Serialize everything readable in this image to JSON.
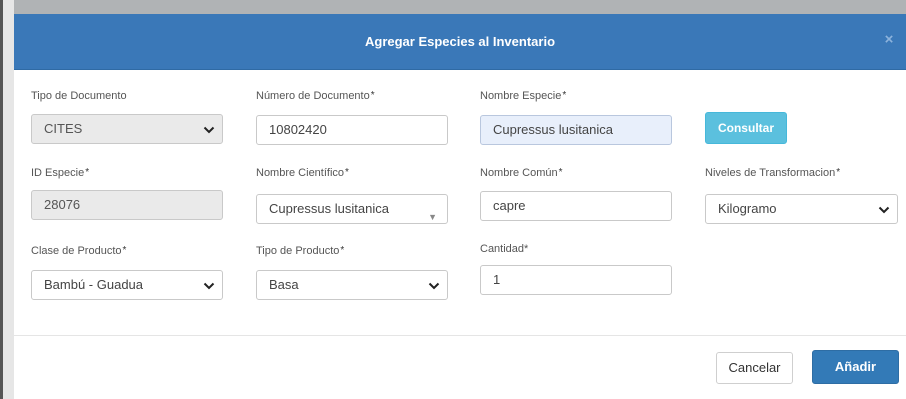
{
  "modal": {
    "title": "Agregar Especies al Inventario",
    "close_symbol": "×"
  },
  "form": {
    "tipo_documento": {
      "label": "Tipo de Documento",
      "value": "CITES"
    },
    "numero_documento": {
      "label": "Número de Documento",
      "required_mark": "*",
      "value": "10802420"
    },
    "nombre_especie": {
      "label": "Nombre Especie",
      "required_mark": "*",
      "value": "Cupressus lusitanica"
    },
    "consultar_label": "Consultar",
    "id_especie": {
      "label": "ID Especie",
      "required_mark": "*",
      "value": "28076"
    },
    "nombre_cientifico": {
      "label": "Nombre Científico",
      "required_mark": "*",
      "value": "Cupressus lusitanica"
    },
    "nombre_comun": {
      "label": "Nombre Común",
      "required_mark": "*",
      "value": "capre"
    },
    "niveles_transformacion": {
      "label": "Niveles de Transformacion",
      "required_mark": "*",
      "value": "Kilogramo"
    },
    "clase_producto": {
      "label": "Clase de Producto",
      "required_mark": "*",
      "value": "Bambú - Guadua"
    },
    "tipo_producto": {
      "label": "Tipo de Producto",
      "required_mark": "*",
      "value": "Basa"
    },
    "cantidad": {
      "label": "Cantidad*",
      "value": "1"
    }
  },
  "footer": {
    "cancel_label": "Cancelar",
    "add_label": "Añadir"
  },
  "colors": {
    "header": "#3a78b8",
    "consultar": "#5bc0de",
    "primary": "#337ab7"
  },
  "icons": {
    "select_arrow": "chevron-down-icon",
    "small_arrow": "caret-down-icon",
    "close": "close-icon"
  }
}
